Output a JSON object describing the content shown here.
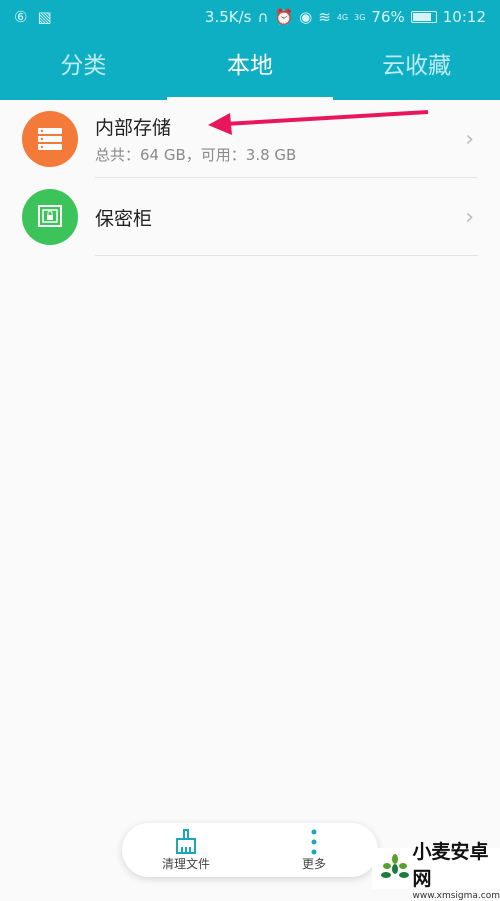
{
  "status_bar": {
    "net_speed": "3.5K/s",
    "battery": "76%",
    "battery_level": 0.76,
    "time": "10:12",
    "network_1": "4G",
    "network_2": "3G"
  },
  "tabs": [
    {
      "label": "分类",
      "active": false
    },
    {
      "label": "本地",
      "active": true
    },
    {
      "label": "云收藏",
      "active": false
    }
  ],
  "items": [
    {
      "title": "内部存储",
      "subtitle": "总共：64 GB，可用：3.8 GB",
      "icon": "storage-icon",
      "color": "#f47a3a"
    },
    {
      "title": "保密柜",
      "icon": "safe-lock-icon",
      "color": "#3cc35a"
    }
  ],
  "annotation": {
    "arrow_color": "#e8175d"
  },
  "bottom_bar": {
    "clean": "清理文件",
    "more": "更多"
  },
  "watermark": {
    "name": "小麦安卓网",
    "url": "www.xmsigma.com"
  },
  "colors": {
    "header": "#0eafc3"
  }
}
